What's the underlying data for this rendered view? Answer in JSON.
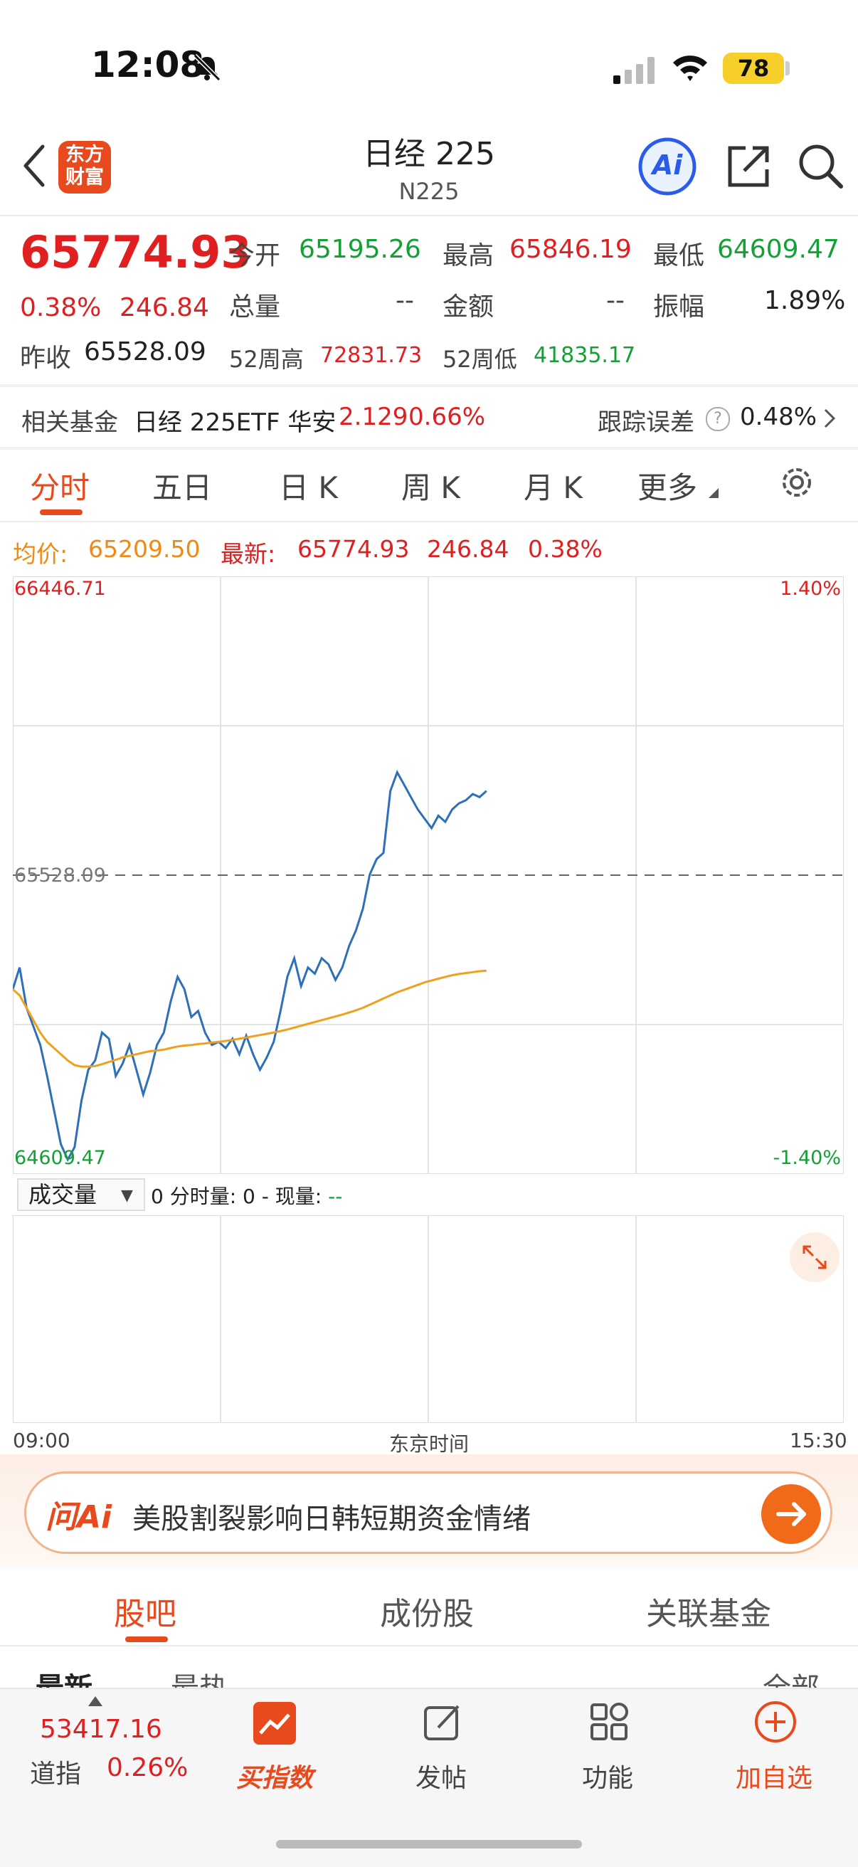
{
  "status": {
    "time": "12:08",
    "battery": "78"
  },
  "header": {
    "title": "日经 225",
    "subtitle": "N225",
    "logo_line1": "东方",
    "logo_line2": "财富",
    "ai_label": "Ai"
  },
  "quote": {
    "price": "65774.93",
    "change_pct": "0.38%",
    "change": "246.84",
    "open_label": "今开",
    "open": "65195.26",
    "high_label": "最高",
    "high": "65846.19",
    "low_label": "最低",
    "low": "64609.47",
    "volume_label": "总量",
    "volume": "--",
    "amount_label": "金额",
    "amount": "--",
    "amplitude_label": "振幅",
    "amplitude": "1.89%",
    "prev_close_label": "昨收",
    "prev_close": "65528.09",
    "w52_high_label": "52周高",
    "w52_high": "72831.73",
    "w52_low_label": "52周低",
    "w52_low": "41835.17"
  },
  "fund": {
    "label": "相关基金",
    "name": "日经 225ETF 华安",
    "price": "2.129",
    "pct": "0.66%",
    "tracking_label": "跟踪误差",
    "tracking_value": "0.48%"
  },
  "tabs": [
    "分时",
    "五日",
    "日 K",
    "周 K",
    "月 K",
    "更多"
  ],
  "info": {
    "avg_label": "均价:",
    "avg": "65209.50",
    "latest_label": "最新:",
    "latest": "65774.93",
    "change": "246.84",
    "pct": "0.38%"
  },
  "chart_data": {
    "type": "line",
    "title": "",
    "xlabel": "东京时间",
    "x_range": [
      "09:00",
      "15:30"
    ],
    "y_max_label": "66446.71",
    "y_min_label": "64609.47",
    "y_max_pct": "1.40%",
    "y_min_pct": "-1.40%",
    "y_ref_label": "65528.09",
    "ylim": [
      64609.47,
      66446.71
    ],
    "reference": 65528.09,
    "series": [
      {
        "name": "price",
        "color": "#2d6fb8",
        "values": [
          65160,
          65230,
          65100,
          65040,
          64980,
          64880,
          64770,
          64660,
          64610,
          64650,
          64800,
          64900,
          64930,
          65020,
          65000,
          64880,
          64920,
          64980,
          64900,
          64820,
          64890,
          64980,
          65020,
          65120,
          65200,
          65160,
          65070,
          65090,
          65020,
          64980,
          64990,
          64970,
          65000,
          64950,
          65010,
          64950,
          64900,
          64940,
          64990,
          65090,
          65200,
          65260,
          65170,
          65230,
          65210,
          65260,
          65240,
          65190,
          65230,
          65300,
          65350,
          65420,
          65530,
          65580,
          65600,
          65800,
          65860,
          65820,
          65780,
          65740,
          65710,
          65680,
          65720,
          65700,
          65740,
          65760,
          65770,
          65790,
          65780,
          65800
        ]
      },
      {
        "name": "avg",
        "color": "#f0a020",
        "values": [
          65160,
          65140,
          65100,
          65060,
          65020,
          64990,
          64970,
          64950,
          64930,
          64915,
          64910,
          64910,
          64912,
          64918,
          64925,
          64932,
          64940,
          64945,
          64950,
          64955,
          64960,
          64962,
          64965,
          64970,
          64975,
          64978,
          64980,
          64983,
          64985,
          64988,
          64990,
          64993,
          64996,
          65000,
          65004,
          65008,
          65012,
          65016,
          65020,
          65025,
          65030,
          65036,
          65042,
          65048,
          65054,
          65060,
          65066,
          65072,
          65078,
          65085,
          65092,
          65100,
          65110,
          65120,
          65130,
          65140,
          65150,
          65158,
          65166,
          65174,
          65182,
          65188,
          65194,
          65200,
          65205,
          65209,
          65212,
          65215,
          65218,
          65220
        ]
      }
    ],
    "progress_fraction": 0.57
  },
  "volume": {
    "select": "成交量",
    "info_prefix": "0 分时量: 0 - 现量:",
    "info_value": "--",
    "time_left": "09:00",
    "time_mid": "东京时间",
    "time_right": "15:30"
  },
  "ai": {
    "logo": "问Ai",
    "text": "美股割裂影响日韩短期资金情绪"
  },
  "bottom_tabs": [
    "股吧",
    "成份股",
    "关联基金"
  ],
  "cut_row": {
    "left": "最新",
    "mid": "最热",
    "right": "全部"
  },
  "nav": {
    "index_value": "53417.16",
    "index_name": "道指",
    "index_pct": "0.26%",
    "items": [
      "买指数",
      "发帖",
      "功能",
      "加自选"
    ]
  },
  "colors": {
    "red": "#e02020",
    "green": "#13a035",
    "orange": "#e8491d",
    "blue": "#2d6fb8"
  }
}
